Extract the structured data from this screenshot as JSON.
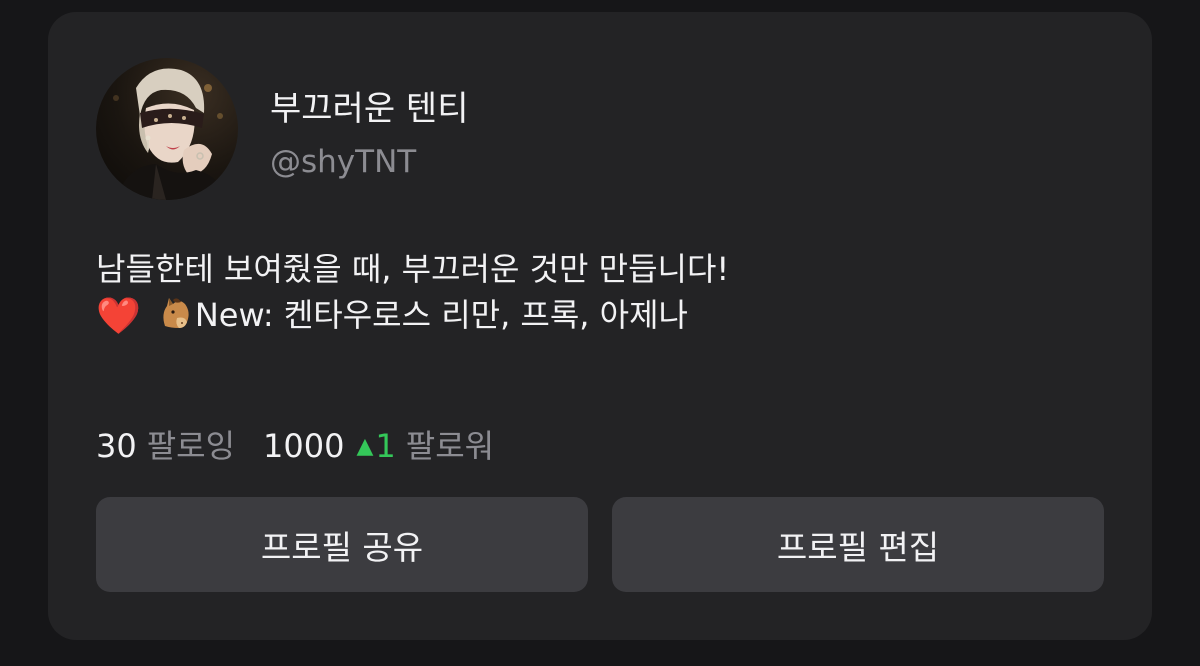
{
  "profile": {
    "display_name": "부끄러운 텐티",
    "handle": "@shyTNT",
    "avatar_icon": "profile-photo-avatar"
  },
  "bio": {
    "line1": "남들한테 보여줬을 때, 부끄러운 것만 만듭니다!",
    "line2_emoji1": "❤️",
    "line2_emoji2_icon": "horse-face-icon",
    "line2_text": "New: 켄타우로스 리만, 프록, 아제나"
  },
  "stats": {
    "following_count": "30",
    "following_label": "팔로잉",
    "followers_count": "1000",
    "followers_change_arrow": "▲",
    "followers_change": "1",
    "followers_label": "팔로워",
    "change_color": "#34c759"
  },
  "buttons": {
    "share_label": "프로필 공유",
    "edit_label": "프로필 편집"
  },
  "colors": {
    "background": "#161618",
    "card": "#232325",
    "button": "#3c3c40",
    "text_primary": "#f2f2f4",
    "text_secondary": "#8c8c92"
  }
}
